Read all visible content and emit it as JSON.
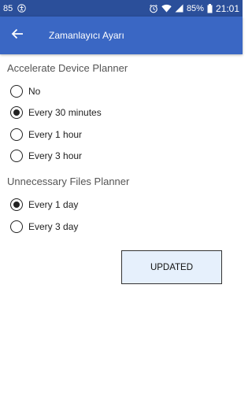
{
  "status_bar": {
    "notification_count": "85",
    "battery_percent": "85%",
    "time": "21:01"
  },
  "app_bar": {
    "title": "Zamanlayıcı Ayarı"
  },
  "accelerate": {
    "header": "Accelerate Device Planner",
    "options": [
      "No",
      "Every 30 minutes",
      "Every 1 hour",
      "Every 3 hour"
    ],
    "selected": "Every 30 minutes"
  },
  "files": {
    "header": "Unnecessary Files Planner",
    "options": [
      "Every 1 day",
      "Every 3 day"
    ],
    "selected": "Every 1 day"
  },
  "button": {
    "label": "UPDATED"
  },
  "colors": {
    "status_bar": "#2b4f9a",
    "app_bar": "#3a67c4",
    "button_bg": "#e6f0fc"
  }
}
